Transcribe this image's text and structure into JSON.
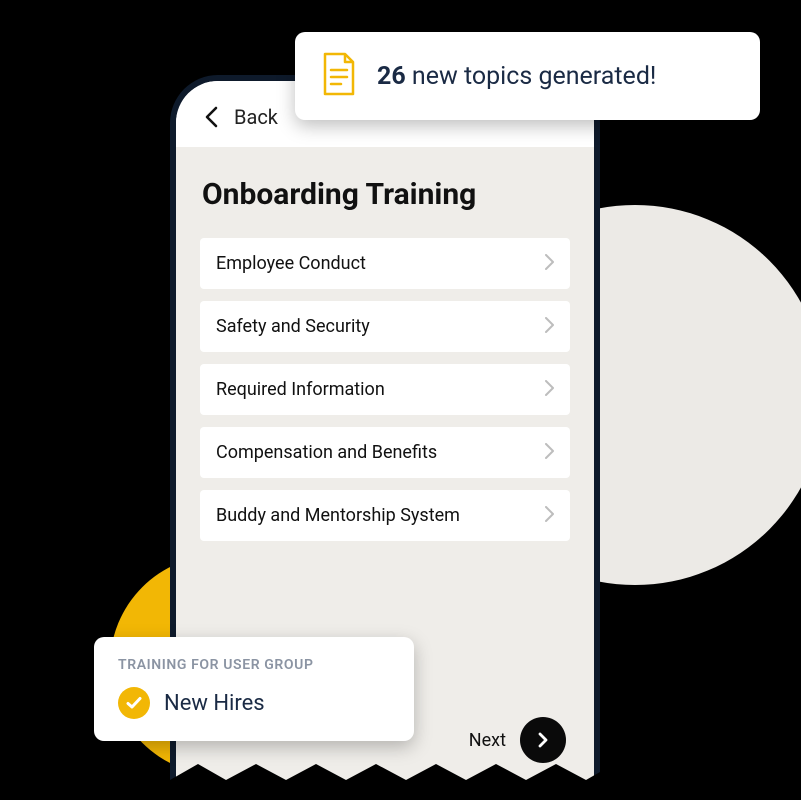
{
  "callout": {
    "count": "26",
    "text_rest": " new topics generated!"
  },
  "nav": {
    "back_label": "Back"
  },
  "page": {
    "title": "Onboarding Training"
  },
  "topics": [
    {
      "label": "Employee Conduct"
    },
    {
      "label": "Safety and Security"
    },
    {
      "label": "Required Information"
    },
    {
      "label": "Compensation and Benefits"
    },
    {
      "label": "Buddy and Mentorship System"
    }
  ],
  "next_label": "Next",
  "usergroup": {
    "heading": "TRAINING FOR USER GROUP",
    "value": "New Hires"
  },
  "colors": {
    "accent_yellow": "#f2b705",
    "dark_navy": "#0e1a2b",
    "bg_grey": "#efede9"
  }
}
